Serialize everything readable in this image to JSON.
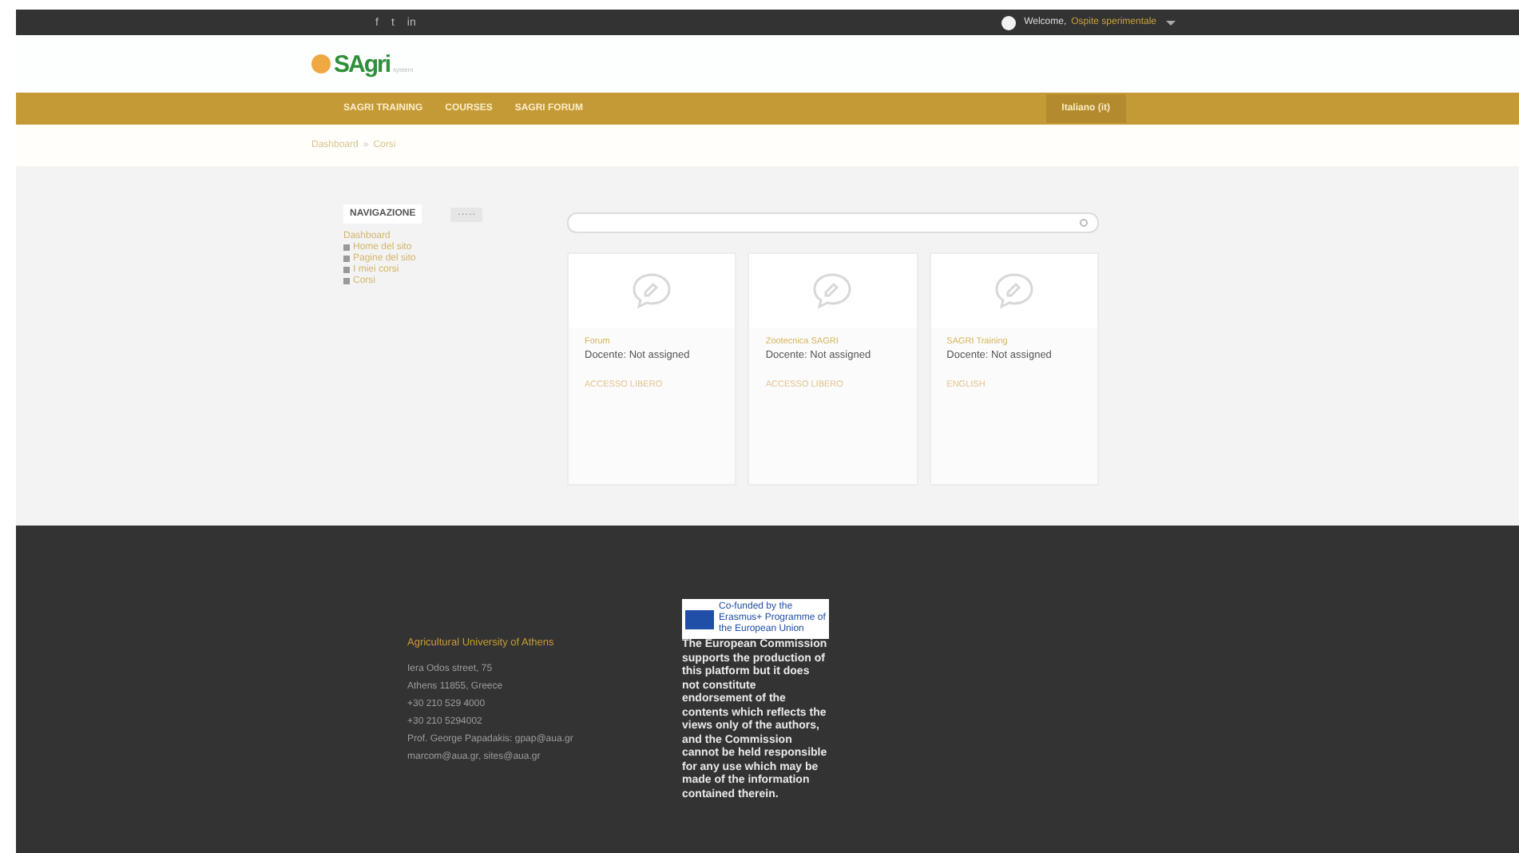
{
  "top_bar": {
    "social": [
      "f",
      "t",
      "in"
    ],
    "welcome": "Welcome,",
    "user": "Ospite sperimentale"
  },
  "logo": {
    "name": "SAgri",
    "suffix": "system"
  },
  "nav": {
    "items": [
      {
        "label": "SAGRI TRAINING"
      },
      {
        "label": "COURSES"
      },
      {
        "label": "SAGRI FORUM"
      }
    ],
    "language": "Italiano (it)"
  },
  "breadcrumb": {
    "items": [
      "Dashboard",
      "Corsi"
    ],
    "separator": "»"
  },
  "navigation_block": {
    "title": "NAVIGAZIONE",
    "tab": "·····",
    "items": [
      {
        "label": "Dashboard",
        "bullet": false
      },
      {
        "label": "Home del sito",
        "bullet": true
      },
      {
        "label": "Pagine del sito",
        "bullet": true
      },
      {
        "label": "I miei corsi",
        "bullet": true
      },
      {
        "label": "Corsi",
        "bullet": true
      }
    ]
  },
  "courses": [
    {
      "category": "Forum",
      "teacher": "Docente: Not assigned",
      "access": "ACCESSO LIBERO"
    },
    {
      "category": "Zootecnica SAGRI",
      "teacher": "Docente: Not assigned",
      "access": "ACCESSO LIBERO"
    },
    {
      "category": "SAGRI Training",
      "teacher": "Docente: Not assigned",
      "access": "ENGLISH"
    }
  ],
  "footer": {
    "title": "Agricultural University of Athens",
    "lines": [
      "Iera Odos street, 75",
      "Athens 11855, Greece",
      "+30 210 529 4000",
      "+30 210 5294002",
      "Prof. George Papadakis: gpap@aua.gr",
      "marcom@aua.gr, sites@aua.gr"
    ],
    "eu_badge": "Co-funded by the Erasmus+ Programme of the European Union",
    "disclaimer": "The European Commission supports the production of this platform but it does not constitute endorsement of the contents which reflects the views only of the authors, and the Commission cannot be held responsible for any use which may be made of the information contained therein."
  }
}
